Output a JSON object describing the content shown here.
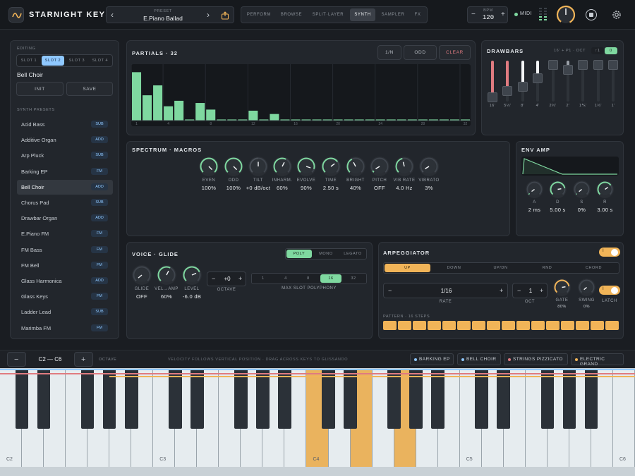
{
  "app": {
    "name": "STARNIGHT KEYS",
    "preset_label": "PRESET",
    "preset_name": "E.Piano Ballad",
    "prev": "‹",
    "next": "›"
  },
  "nav": {
    "tabs": [
      "PERFORM",
      "BROWSE",
      "SPLIT·LAYER",
      "SYNTH",
      "SAMPLER",
      "FX"
    ],
    "active": "SYNTH"
  },
  "tempo": {
    "label": "BPM",
    "value": "120",
    "minus": "−",
    "plus": "+"
  },
  "midi": {
    "label": "MIDI"
  },
  "editing": {
    "label": "EDITING",
    "slots": [
      "SLOT 1",
      "SLOT 2",
      "SLOT 3",
      "SLOT 4"
    ],
    "active_slot": "SLOT 2",
    "patch_name": "Bell Choir",
    "init": "INIT",
    "save": "SAVE",
    "presets_label": "SYNTH PRESETS",
    "presets": [
      {
        "name": "Acid Bass",
        "tag": "SUB"
      },
      {
        "name": "Additive Organ",
        "tag": "ADD"
      },
      {
        "name": "Arp Pluck",
        "tag": "SUB"
      },
      {
        "name": "Barking EP",
        "tag": "FM"
      },
      {
        "name": "Bell Choir",
        "tag": "ADD"
      },
      {
        "name": "Chorus Pad",
        "tag": "SUB"
      },
      {
        "name": "Drawbar Organ",
        "tag": "ADD"
      },
      {
        "name": "E.Piano FM",
        "tag": "FM"
      },
      {
        "name": "FM Bass",
        "tag": "FM"
      },
      {
        "name": "FM Bell",
        "tag": "FM"
      },
      {
        "name": "Glass Harmonica",
        "tag": "ADD"
      },
      {
        "name": "Glass Keys",
        "tag": "FM"
      },
      {
        "name": "Ladder Lead",
        "tag": "SUB"
      },
      {
        "name": "Marimba FM",
        "tag": "FM"
      }
    ]
  },
  "partials": {
    "title": "PARTIALS · 32",
    "btn_1n": "1/N",
    "btn_odd": "ODD",
    "btn_clear": "CLEAR",
    "levels": [
      0.88,
      0.46,
      0.64,
      0.26,
      0.36,
      0.02,
      0.32,
      0.2,
      0.02,
      0.02,
      0.02,
      0.18,
      0.02,
      0.12,
      0.02,
      0.02,
      0.02,
      0.02,
      0.02,
      0.02,
      0.02,
      0.02,
      0.02,
      0.02,
      0.02,
      0.02,
      0.02,
      0.02,
      0.02,
      0.02,
      0.02,
      0.02
    ],
    "ticks": [
      "1",
      "4",
      "8",
      "12",
      "16",
      "20",
      "24",
      "28",
      "32"
    ]
  },
  "drawbars": {
    "title": "DRAWBARS",
    "sub": "16' + P1 · OCT",
    "btn_a": "↑1",
    "btn_b": "0",
    "bars": [
      {
        "label": "16'",
        "level": 0.88,
        "color": "#e07b80"
      },
      {
        "label": "5⅓'",
        "level": 0.72,
        "color": "#e07b80"
      },
      {
        "label": "8'",
        "level": 0.62,
        "color": "#f4f6f8"
      },
      {
        "label": "4'",
        "level": 0.42,
        "color": "#f4f6f8"
      },
      {
        "label": "2⅔'",
        "level": 0.08,
        "color": "#9aa0a8"
      },
      {
        "label": "2'",
        "level": 0.2,
        "color": "#9aa0a8"
      },
      {
        "label": "1⅗'",
        "level": 0.08,
        "color": "#9aa0a8"
      },
      {
        "label": "1⅓'",
        "level": 0.08,
        "color": "#9aa0a8"
      },
      {
        "label": "1'",
        "level": 0.08,
        "color": "#9aa0a8"
      }
    ]
  },
  "spectrum": {
    "title": "SPECTRUM · MACROS",
    "knobs": [
      {
        "label": "EVEN",
        "value": "100%",
        "amt": 1.0,
        "color": "#7fd8a0"
      },
      {
        "label": "ODD",
        "value": "100%",
        "amt": 1.0,
        "color": "#7fd8a0"
      },
      {
        "label": "TILT",
        "value": "+0 dB/oct",
        "amt": 0.5,
        "color": "#4a5058"
      },
      {
        "label": "INHARM.",
        "value": "60%",
        "amt": 0.6,
        "color": "#7fd8a0"
      },
      {
        "label": "EVOLVE",
        "value": "90%",
        "amt": 0.9,
        "color": "#7fd8a0"
      },
      {
        "label": "TIME",
        "value": "2.50 s",
        "amt": 0.7,
        "color": "#7fd8a0"
      },
      {
        "label": "BRIGHT",
        "value": "40%",
        "amt": 0.4,
        "color": "#7fd8a0"
      },
      {
        "label": "PITCH",
        "value": "OFF",
        "amt": 0.05,
        "color": "#7fd8a0"
      },
      {
        "label": "VIB RATE",
        "value": "4.0 Hz",
        "amt": 0.45,
        "color": "#7fd8a0"
      },
      {
        "label": "VIBRATO",
        "value": "3%",
        "amt": 0.05,
        "color": "#4a5058"
      }
    ]
  },
  "env": {
    "title": "ENV AMP",
    "knobs": [
      {
        "label": "A",
        "value": "2 ms",
        "amt": 0.03
      },
      {
        "label": "D",
        "value": "5.00 s",
        "amt": 0.8
      },
      {
        "label": "S",
        "value": "0%",
        "amt": 0.02
      },
      {
        "label": "R",
        "value": "3.00 s",
        "amt": 0.7
      }
    ]
  },
  "voice": {
    "title": "VOICE · GLIDE",
    "modes": [
      "POLY",
      "MONO",
      "LEGATO"
    ],
    "active_mode": "POLY",
    "knobs": [
      {
        "label": "GLIDE",
        "value": "OFF",
        "amt": 0.02,
        "color": "#4a5058"
      },
      {
        "label": "VEL→AMP",
        "value": "60%",
        "amt": 0.6,
        "color": "#7fd8a0"
      },
      {
        "label": "LEVEL",
        "value": "-6.0 dB",
        "amt": 0.75,
        "color": "#7fd8a0"
      }
    ],
    "octave": {
      "minus": "−",
      "value": "+0",
      "plus": "+",
      "label": "OCTAVE"
    },
    "polyphony": {
      "options": [
        "1",
        "4",
        "8",
        "16",
        "32"
      ],
      "active": "16",
      "label": "MAX SLOT POLYPHONY"
    }
  },
  "arp": {
    "title": "ARPEGGIATOR",
    "toggle": "I",
    "modes": [
      "UP",
      "DOWN",
      "UP/DN",
      "RND",
      "CHORD"
    ],
    "active_mode": "UP",
    "rate": {
      "minus": "−",
      "value": "1/16",
      "plus": "+",
      "label": "RATE"
    },
    "oct": {
      "minus": "−",
      "value": "1",
      "plus": "+",
      "label": "OCT"
    },
    "gate": {
      "label": "GATE",
      "value": "80%",
      "amt": 0.8
    },
    "swing": {
      "label": "SWING",
      "value": "0%",
      "amt": 0.02
    },
    "latch": {
      "label": "LATCH",
      "toggle": "I"
    },
    "pattern_label": "PATTERN · 16 STEPS"
  },
  "keyboard": {
    "minus": "−",
    "range": "C2 — C6",
    "plus": "+",
    "octave_label": "OCTAVE",
    "hint": "VELOCITY FOLLOWS VERTICAL POSITION · DRAG ACROSS KEYS TO GLISSANDO",
    "layers": [
      {
        "name": "BARKING EP",
        "color": "#8fc8ff"
      },
      {
        "name": "BELL CHOIR",
        "color": "#8fc8ff"
      },
      {
        "name": "STRINGS PIZZICATO",
        "color": "#e07b80"
      },
      {
        "name": "ELECTRIC GRAND",
        "color": "#f1b458"
      }
    ],
    "octave_labels": [
      "C2",
      "C3",
      "C4",
      "C5",
      "C6"
    ]
  },
  "colors": {
    "accent_green": "#7fd8a0",
    "accent_orange": "#f1b458",
    "accent_blue": "#8fc8ff",
    "accent_red": "#e07b80"
  }
}
